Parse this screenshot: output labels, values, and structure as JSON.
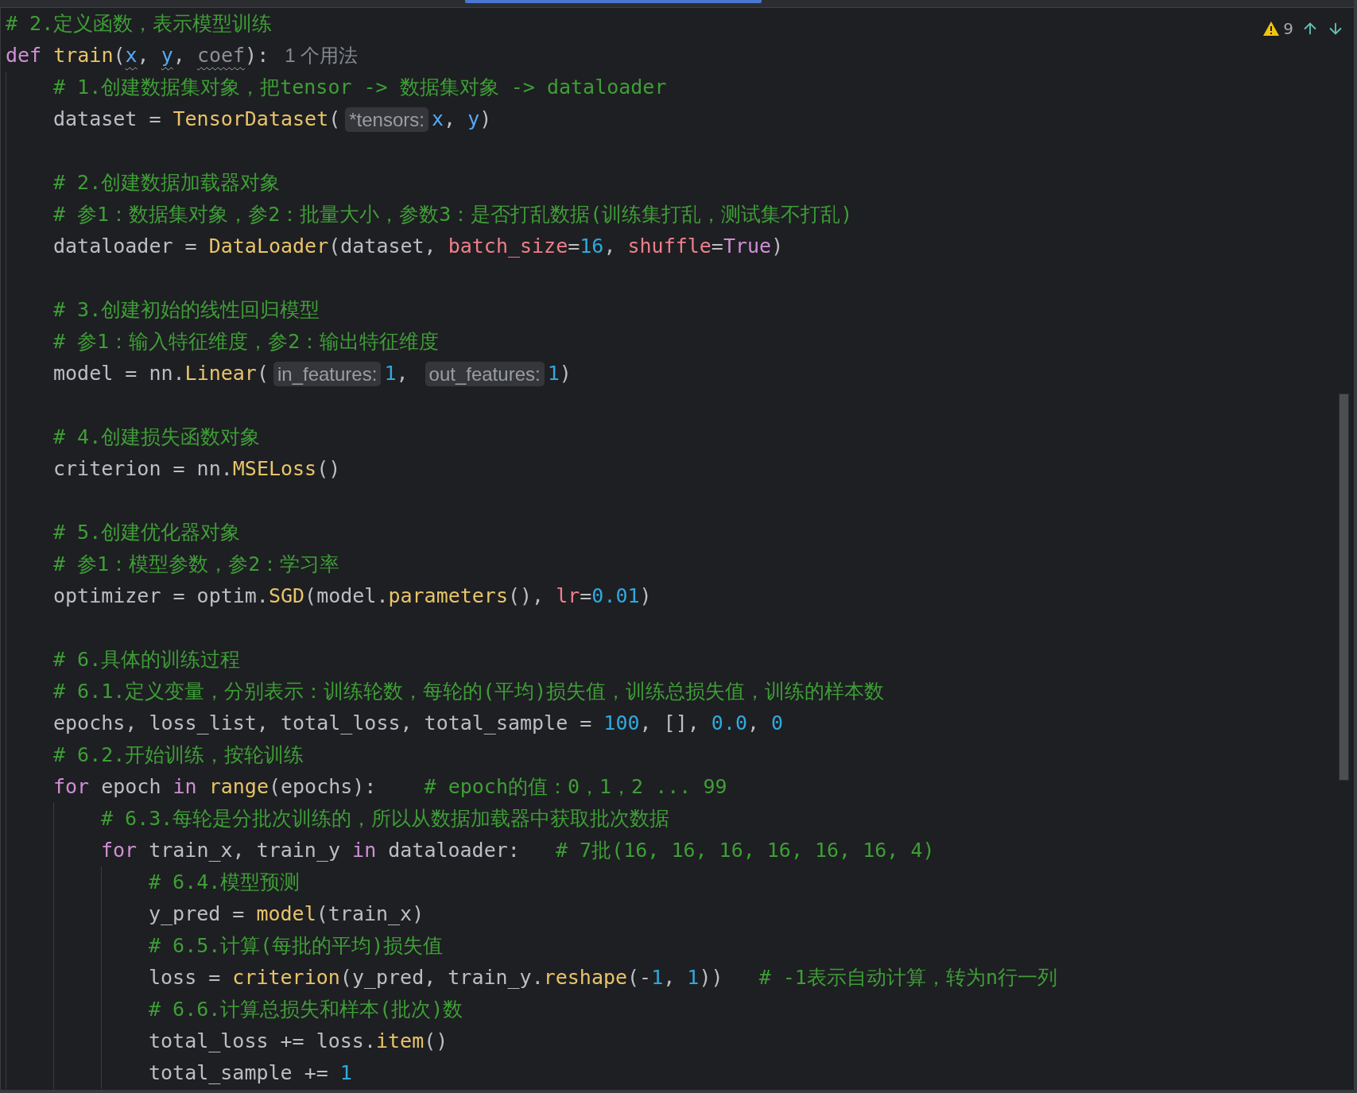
{
  "problems": {
    "warnings": "9"
  },
  "code": {
    "lines": [
      {
        "tokens": [
          {
            "kind": "comment",
            "text": "# 2.定义函数，表示模型训练"
          }
        ]
      },
      {
        "tokens": [
          {
            "kind": "keyword",
            "text": "def "
          },
          {
            "kind": "function",
            "text": "train"
          },
          {
            "kind": "plain",
            "text": "("
          },
          {
            "kind": "param",
            "text": "x",
            "warning": true
          },
          {
            "kind": "plain",
            "text": ", "
          },
          {
            "kind": "param",
            "text": "y",
            "warning": true
          },
          {
            "kind": "plain",
            "text": ", "
          },
          {
            "kind": "unused",
            "text": "coef",
            "warning": true
          },
          {
            "kind": "plain",
            "text": "):"
          },
          {
            "kind": "usage",
            "text": "1 个用法"
          }
        ],
        "children": [
          {
            "tokens": [
              {
                "kind": "comment",
                "text": "# 1.创建数据集对象，把tensor -> 数据集对象 -> dataloader"
              }
            ]
          },
          {
            "tokens": [
              {
                "kind": "plain",
                "text": "dataset = "
              },
              {
                "kind": "function",
                "text": "TensorDataset"
              },
              {
                "kind": "plain",
                "text": "("
              },
              {
                "kind": "hint",
                "text": "*tensors:"
              },
              {
                "kind": "param",
                "text": "x"
              },
              {
                "kind": "plain",
                "text": ", "
              },
              {
                "kind": "param",
                "text": "y"
              },
              {
                "kind": "plain",
                "text": ")"
              }
            ]
          },
          {
            "gap_before": true,
            "tokens": [
              {
                "kind": "comment",
                "text": "# 2.创建数据加载器对象"
              }
            ]
          },
          {
            "tokens": [
              {
                "kind": "comment",
                "text": "# 参1：数据集对象，参2：批量大小，参数3：是否打乱数据(训练集打乱，测试集不打乱)"
              }
            ]
          },
          {
            "tokens": [
              {
                "kind": "plain",
                "text": "dataloader = "
              },
              {
                "kind": "function",
                "text": "DataLoader"
              },
              {
                "kind": "plain",
                "text": "(dataset, "
              },
              {
                "kind": "kwarg",
                "text": "batch_size"
              },
              {
                "kind": "plain",
                "text": "="
              },
              {
                "kind": "number",
                "text": "16"
              },
              {
                "kind": "plain",
                "text": ", "
              },
              {
                "kind": "kwarg",
                "text": "shuffle"
              },
              {
                "kind": "plain",
                "text": "="
              },
              {
                "kind": "keyword",
                "text": "True"
              },
              {
                "kind": "plain",
                "text": ")"
              }
            ]
          },
          {
            "gap_before": true,
            "tokens": [
              {
                "kind": "comment",
                "text": "# 3.创建初始的线性回归模型"
              }
            ]
          },
          {
            "tokens": [
              {
                "kind": "comment",
                "text": "# 参1：输入特征维度，参2：输出特征维度"
              }
            ]
          },
          {
            "tokens": [
              {
                "kind": "plain",
                "text": "model = nn."
              },
              {
                "kind": "function",
                "text": "Linear"
              },
              {
                "kind": "plain",
                "text": "("
              },
              {
                "kind": "hint",
                "text": "in_features:"
              },
              {
                "kind": "number",
                "text": "1"
              },
              {
                "kind": "plain",
                "text": ", "
              },
              {
                "kind": "hint",
                "text": "out_features:"
              },
              {
                "kind": "number",
                "text": "1"
              },
              {
                "kind": "plain",
                "text": ")"
              }
            ]
          },
          {
            "gap_before": true,
            "tokens": [
              {
                "kind": "comment",
                "text": "# 4.创建损失函数对象"
              }
            ]
          },
          {
            "tokens": [
              {
                "kind": "plain",
                "text": "criterion = nn."
              },
              {
                "kind": "function",
                "text": "MSELoss"
              },
              {
                "kind": "plain",
                "text": "()"
              }
            ]
          },
          {
            "gap_before": true,
            "tokens": [
              {
                "kind": "comment",
                "text": "# 5.创建优化器对象"
              }
            ]
          },
          {
            "tokens": [
              {
                "kind": "comment",
                "text": "# 参1：模型参数，参2：学习率"
              }
            ]
          },
          {
            "tokens": [
              {
                "kind": "plain",
                "text": "optimizer = optim."
              },
              {
                "kind": "function",
                "text": "SGD"
              },
              {
                "kind": "plain",
                "text": "(model."
              },
              {
                "kind": "function",
                "text": "parameters"
              },
              {
                "kind": "plain",
                "text": "(), "
              },
              {
                "kind": "kwarg",
                "text": "lr"
              },
              {
                "kind": "plain",
                "text": "="
              },
              {
                "kind": "number",
                "text": "0.01"
              },
              {
                "kind": "plain",
                "text": ")"
              }
            ]
          },
          {
            "gap_before": true,
            "tokens": [
              {
                "kind": "comment",
                "text": "# 6.具体的训练过程"
              }
            ]
          },
          {
            "tokens": [
              {
                "kind": "comment",
                "text": "# 6.1.定义变量，分别表示：训练轮数，每轮的(平均)损失值，训练总损失值，训练的样本数"
              }
            ]
          },
          {
            "tokens": [
              {
                "kind": "plain",
                "text": "epochs, loss_list, total_loss, total_sample = "
              },
              {
                "kind": "number",
                "text": "100"
              },
              {
                "kind": "plain",
                "text": ", [], "
              },
              {
                "kind": "number",
                "text": "0.0"
              },
              {
                "kind": "plain",
                "text": ", "
              },
              {
                "kind": "number",
                "text": "0"
              }
            ]
          },
          {
            "tokens": [
              {
                "kind": "comment",
                "text": "# 6.2.开始训练，按轮训练"
              }
            ]
          },
          {
            "tokens": [
              {
                "kind": "keyword",
                "text": "for"
              },
              {
                "kind": "plain",
                "text": " epoch "
              },
              {
                "kind": "keyword",
                "text": "in "
              },
              {
                "kind": "function",
                "text": "range"
              },
              {
                "kind": "plain",
                "text": "(epochs):    "
              },
              {
                "kind": "comment",
                "text": "# epoch的值：0，1，2 ... 99"
              }
            ],
            "children": [
              {
                "tokens": [
                  {
                    "kind": "comment",
                    "text": "# 6.3.每轮是分批次训练的，所以从数据加载器中获取批次数据"
                  }
                ]
              },
              {
                "tokens": [
                  {
                    "kind": "keyword",
                    "text": "for"
                  },
                  {
                    "kind": "plain",
                    "text": " train_x, train_y "
                  },
                  {
                    "kind": "keyword",
                    "text": "in"
                  },
                  {
                    "kind": "plain",
                    "text": " dataloader:   "
                  },
                  {
                    "kind": "comment",
                    "text": "# 7批(16, 16, 16, 16, 16, 16, 4)"
                  }
                ],
                "children": [
                  {
                    "tokens": [
                      {
                        "kind": "comment",
                        "text": "# 6.4.模型预测"
                      }
                    ]
                  },
                  {
                    "tokens": [
                      {
                        "kind": "plain",
                        "text": "y_pred = "
                      },
                      {
                        "kind": "function",
                        "text": "model"
                      },
                      {
                        "kind": "plain",
                        "text": "(train_x)"
                      }
                    ]
                  },
                  {
                    "tokens": [
                      {
                        "kind": "comment",
                        "text": "# 6.5.计算(每批的平均)损失值"
                      }
                    ]
                  },
                  {
                    "tokens": [
                      {
                        "kind": "plain",
                        "text": "loss = "
                      },
                      {
                        "kind": "function",
                        "text": "criterion"
                      },
                      {
                        "kind": "plain",
                        "text": "(y_pred, train_y."
                      },
                      {
                        "kind": "function",
                        "text": "reshape"
                      },
                      {
                        "kind": "plain",
                        "text": "(-"
                      },
                      {
                        "kind": "number",
                        "text": "1"
                      },
                      {
                        "kind": "plain",
                        "text": ", "
                      },
                      {
                        "kind": "number",
                        "text": "1"
                      },
                      {
                        "kind": "plain",
                        "text": "))   "
                      },
                      {
                        "kind": "comment",
                        "text": "# -1表示自动计算，转为n行一列"
                      }
                    ]
                  },
                  {
                    "tokens": [
                      {
                        "kind": "comment",
                        "text": "# 6.6.计算总损失和样本(批次)数"
                      }
                    ]
                  },
                  {
                    "tokens": [
                      {
                        "kind": "plain",
                        "text": "total_loss += loss."
                      },
                      {
                        "kind": "function",
                        "text": "item"
                      },
                      {
                        "kind": "plain",
                        "text": "()"
                      }
                    ]
                  },
                  {
                    "tokens": [
                      {
                        "kind": "plain",
                        "text": "total_sample += "
                      },
                      {
                        "kind": "number",
                        "text": "1"
                      }
                    ]
                  }
                ]
              }
            ]
          }
        ]
      }
    ]
  }
}
